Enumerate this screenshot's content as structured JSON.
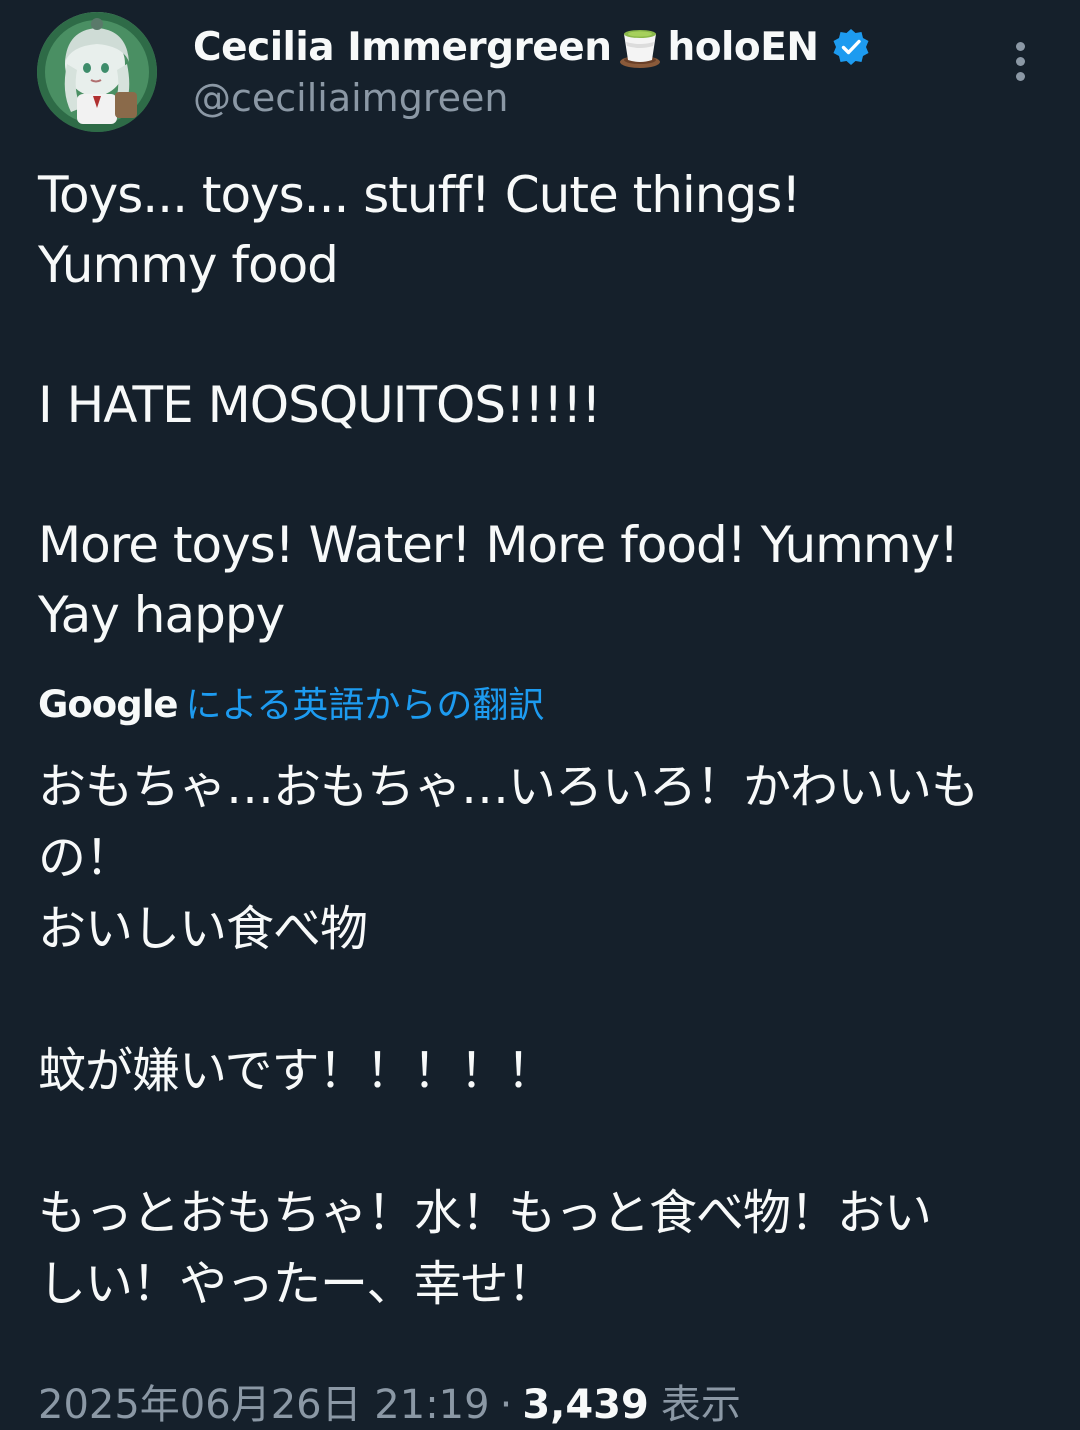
{
  "user": {
    "display_name_part1": "Cecilia Immergreen",
    "name_icon": "matcha-tea-cup-icon",
    "display_name_part2": "holoEN",
    "verified_icon": "verified-badge-icon",
    "verified_color": "#1d9bf0",
    "handle": "@ceciliaimgreen"
  },
  "more_icon": "more-vertical-icon",
  "tweet": {
    "lines": [
      "Toys... toys... stuff! Cute things!",
      "Yummy food",
      "",
      "I HATE MOSQUITOS!!!!!",
      "",
      "More toys! Water! More food! Yummy!",
      "Yay happy"
    ]
  },
  "translation": {
    "provider": "Google",
    "label": "による英語からの翻訳",
    "lines": [
      "おもちゃ…おもちゃ…いろいろ！かわいいも",
      "の！",
      "おいしい食べ物",
      "",
      "蚊が嫌いです！！！！！",
      "",
      "もっとおもちゃ！水！もっと食べ物！おい",
      "しい！やったー、幸せ！"
    ]
  },
  "meta": {
    "timestamp": "2025年06月26日 21:19",
    "separator": "·",
    "views_count": "3,439",
    "views_label": "表示"
  },
  "colors": {
    "background": "#15202b",
    "text_primary": "#f7f9f9",
    "text_secondary": "#8b98a5",
    "link": "#1d9bf0"
  }
}
